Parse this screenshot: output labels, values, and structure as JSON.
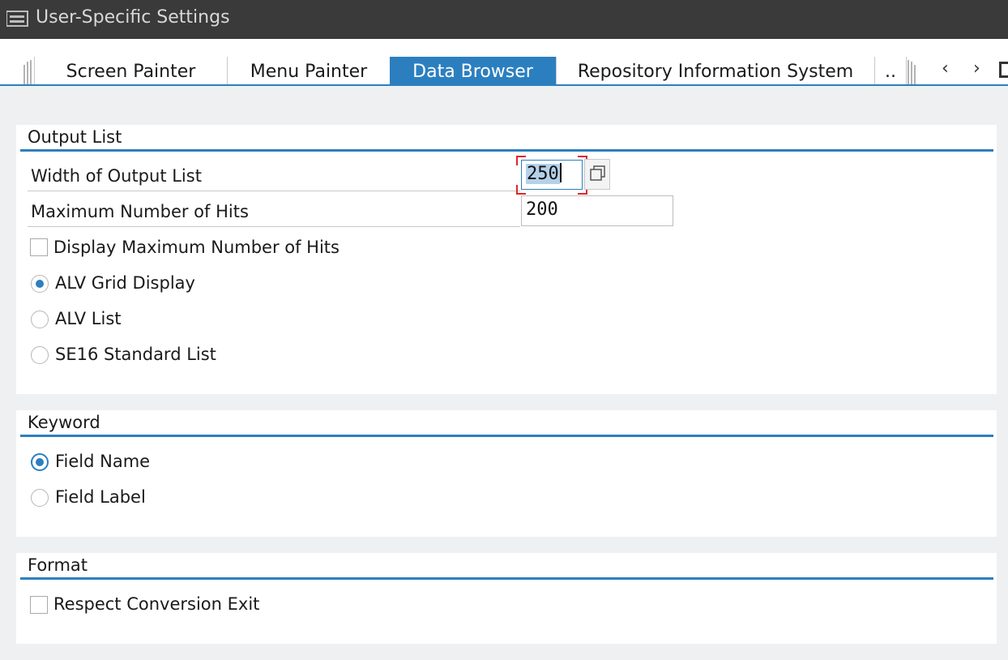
{
  "window": {
    "title": "User-Specific Settings"
  },
  "tabs": [
    {
      "label": "Screen Painter"
    },
    {
      "label": "Menu Painter"
    },
    {
      "label": "Data Browser",
      "active": true
    },
    {
      "label": "Repository Information System"
    },
    {
      "label": ".."
    }
  ],
  "tab_nav": {
    "prev_glyph": "‹",
    "next_glyph": "›"
  },
  "output_list": {
    "title": "Output List",
    "width_label": "Width of Output List",
    "width_value": "250",
    "max_hits_label": "Maximum Number of Hits",
    "max_hits_value": "200",
    "display_max_hits_label": "Display Maximum Number of Hits",
    "display_max_hits_checked": false,
    "display_options": [
      {
        "label": "ALV Grid Display",
        "selected": true
      },
      {
        "label": "ALV List",
        "selected": false
      },
      {
        "label": "SE16 Standard List",
        "selected": false
      }
    ]
  },
  "keyword": {
    "title": "Keyword",
    "options": [
      {
        "label": "Field Name",
        "selected": true
      },
      {
        "label": "Field Label",
        "selected": false
      }
    ]
  },
  "format": {
    "title": "Format",
    "respect_conversion_exit_label": "Respect Conversion Exit",
    "respect_conversion_exit_checked": false
  },
  "colors": {
    "accent": "#2c7fbf",
    "titlebar": "#3a3a3a",
    "focus_frame": "#e0262b"
  }
}
